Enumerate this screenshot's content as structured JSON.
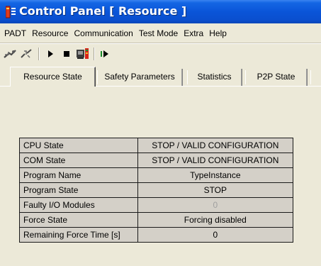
{
  "window": {
    "title": "Control Panel [ Resource ]",
    "title_bar_color": "#0a55d8",
    "icon": "control-panel-app-icon"
  },
  "menu": {
    "items": [
      "PADT",
      "Resource",
      "Communication",
      "Test Mode",
      "Extra",
      "Help"
    ]
  },
  "toolbar": {
    "buttons": [
      {
        "name": "connect-icon"
      },
      {
        "name": "disconnect-icon"
      },
      {
        "name": "start-icon"
      },
      {
        "name": "stop-icon"
      },
      {
        "name": "download-icon"
      },
      {
        "name": "single-step-icon"
      }
    ]
  },
  "tabs": [
    {
      "label": "Resource State",
      "active": true
    },
    {
      "label": "Safety Parameters",
      "active": false
    },
    {
      "label": "Statistics",
      "active": false
    },
    {
      "label": "P2P State",
      "active": false
    }
  ],
  "resource_state": {
    "rows": [
      {
        "label": "CPU State",
        "value": "STOP / VALID CONFIGURATION"
      },
      {
        "label": "COM State",
        "value": "STOP / VALID CONFIGURATION"
      },
      {
        "label": "Program Name",
        "value": "TypeInstance"
      },
      {
        "label": "Program State",
        "value": "STOP"
      },
      {
        "label": "Faulty I/O Modules",
        "value": "0",
        "disabled": true
      },
      {
        "label": "Force State",
        "value": "Forcing disabled"
      },
      {
        "label": "Remaining Force Time [s]",
        "value": "0"
      }
    ]
  }
}
